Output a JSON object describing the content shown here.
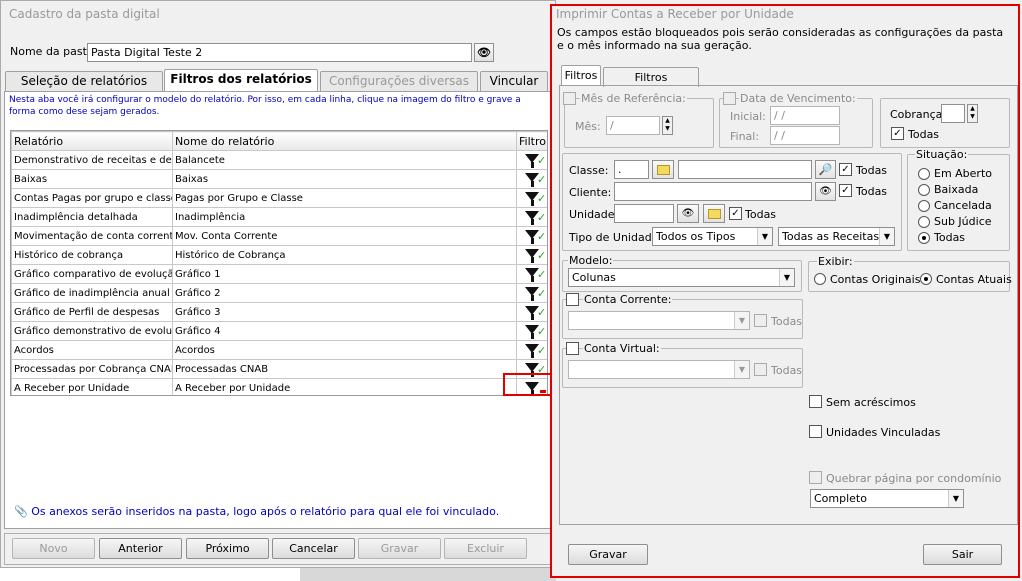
{
  "left": {
    "title": "Cadastro da pasta digital",
    "nome_label": "Nome da pasta:",
    "nome_value": "Pasta Digital Teste 2",
    "tabs": [
      "Seleção de relatórios",
      "Filtros dos relatórios",
      "Configurações diversas",
      "Vincular"
    ],
    "info": "Nesta aba você irá configurar o modelo do relatório. Por isso, em cada linha, clique na imagem do filtro e grave a forma como dese sejam gerados.",
    "columns": [
      "Relatório",
      "Nome do relatório",
      "Filtro"
    ],
    "rows": [
      {
        "relatorio": "Demonstrativo de receitas e despesas",
        "nome": "Balancete"
      },
      {
        "relatorio": "Baixas",
        "nome": "Baixas"
      },
      {
        "relatorio": "Contas Pagas por grupo e classe",
        "nome": "Pagas por Grupo e Classe"
      },
      {
        "relatorio": "Inadimplência detalhada",
        "nome": "Inadimplência"
      },
      {
        "relatorio": "Movimentação de conta corrente",
        "nome": "Mov. Conta Corrente"
      },
      {
        "relatorio": "Histórico de cobrança",
        "nome": "Histórico de Cobrança"
      },
      {
        "relatorio": "Gráfico comparativo de evolução de d",
        "nome": "Gráfico 1"
      },
      {
        "relatorio": "Gráfico de inadimplência anual",
        "nome": "Gráfico 2"
      },
      {
        "relatorio": "Gráfico de Perfil de despesas",
        "nome": "Gráfico 3"
      },
      {
        "relatorio": "Gráfico demonstrativo de evolução de",
        "nome": "Gráfico 4"
      },
      {
        "relatorio": "Acordos",
        "nome": "Acordos"
      },
      {
        "relatorio": "Processadas por Cobrança CNAB",
        "nome": "Processadas CNAB"
      },
      {
        "relatorio": "A Receber por Unidade",
        "nome": "A Receber por Unidade"
      }
    ],
    "footnote": "Os anexos serão inseridos na pasta, logo após o relatório para qual ele foi vinculado.",
    "buttons": [
      "Novo",
      "Anterior",
      "Próximo",
      "Cancelar",
      "Gravar",
      "Excluir"
    ]
  },
  "right": {
    "title": "Imprimir Contas a Receber por Unidade",
    "notice": "Os campos estão bloqueados pois serão consideradas as configurações da pasta e o mês informado na sua geração.",
    "tabs": [
      "Filtros",
      "Filtros Avançados"
    ],
    "mes_ref_label": "Mês de Referência:",
    "mes_label": "Mês:",
    "mes_value": " /",
    "data_venc_label": "Data de Vencimento:",
    "inicial_label": "Inicial:",
    "final_label": "Final:",
    "date_value": " / /",
    "cobranca_label": "Cobrança:",
    "todas": "Todas",
    "classe_label": "Classe:",
    "classe_value": " .",
    "cliente_label": "Cliente:",
    "unidade_label": "Unidade:",
    "tipo_unidade_label": "Tipo de Unidade:",
    "tipo_unidade_value": "Todos os Tipos",
    "receitas_value": "Todas as Receitas",
    "situacao_label": "Situação:",
    "situacao_options": [
      "Em Aberto",
      "Baixada",
      "Cancelada",
      "Sub Júdice",
      "Todas"
    ],
    "modelo_label": "Modelo:",
    "modelo_value": "Colunas",
    "exibir_label": "Exibir:",
    "exibir_options": [
      "Contas Originais",
      "Contas Atuais"
    ],
    "conta_corrente_label": "Conta Corrente:",
    "conta_virtual_label": "Conta Virtual:",
    "sem_acrescimos": "Sem acréscimos",
    "unidades_vinculadas": "Unidades Vinculadas",
    "quebrar_label": "Quebrar página por condomínio",
    "quebrar_value": "Completo",
    "gravar": "Gravar",
    "sair": "Sair"
  },
  "colors": {
    "highlight": "#e00000",
    "info_text": "#0000c0",
    "check_green": "#2a9d2a"
  }
}
